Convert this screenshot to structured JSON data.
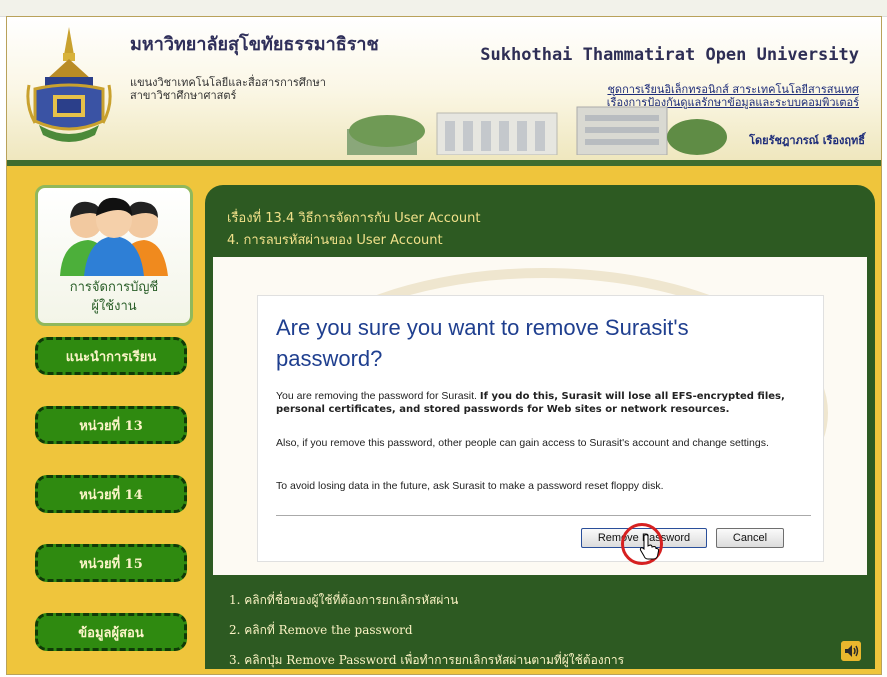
{
  "header": {
    "thai_title": "มหาวิทยาลัยสุโขทัยธรรมาธิราช",
    "thai_sub1": "แขนงวิชาเทคโนโลยีและสื่อสารการศึกษา",
    "thai_sub2": "สาขาวิชาศึกษาศาสตร์",
    "en_title": "Sukhothai Thammatirat Open University",
    "right_line1": "ชุดการเรียนอิเล็กทรอนิกส์ สาระเทคโนโลยีสารสนเทศ",
    "right_line2": "เรื่องการป้องกันดูแลรักษาข้อมูลและระบบคอมพิวเตอร์",
    "author": "โดยรัชฎาภรณ์ เรืองฤทธิ์"
  },
  "sidebar": {
    "card_label_1": "การจัดการบัญชี",
    "card_label_2": "ผู้ใช้งาน",
    "items": [
      {
        "label": "แนะนำการเรียน"
      },
      {
        "label": "หน่วยที่ 13"
      },
      {
        "label": "หน่วยที่ 14"
      },
      {
        "label": "หน่วยที่ 15"
      },
      {
        "label": "ข้อมูลผู้สอน"
      }
    ]
  },
  "main": {
    "heading1": "เรื่องที่ 13.4 วิธีการจัดการกับ User Account",
    "heading2": "4. การลบรหัสผ่านของ User Account"
  },
  "dialog": {
    "title": "Are you sure you want to remove Surasit's password?",
    "p1_normal": "You are removing the password for Surasit. ",
    "p1_bold": "If you do this, Surasit will lose all EFS-encrypted files, personal certificates, and stored passwords for Web sites or network resources.",
    "p2": "Also, if you remove this password, other people can gain access to Surasit's account and change settings.",
    "p3": "To avoid losing data in the future, ask Surasit to make a password reset floppy disk.",
    "remove_button": "Remove Password",
    "cancel_button": "Cancel"
  },
  "steps": [
    "1. คลิกที่ชื่อของผู้ใช้ที่ต้องการยกเลิกรหัสผ่าน",
    "2. คลิกที่ Remove the password",
    "3. คลิกปุ่ม Remove Password เพื่อทำการยกเลิกรหัสผ่านตามที่ผู้ใช้ต้องการ"
  ],
  "colors": {
    "page_bg": "#efc53c",
    "panel_green": "#2d5a22",
    "nav_green": "#2f8a10",
    "highlight_red": "#d62020"
  }
}
